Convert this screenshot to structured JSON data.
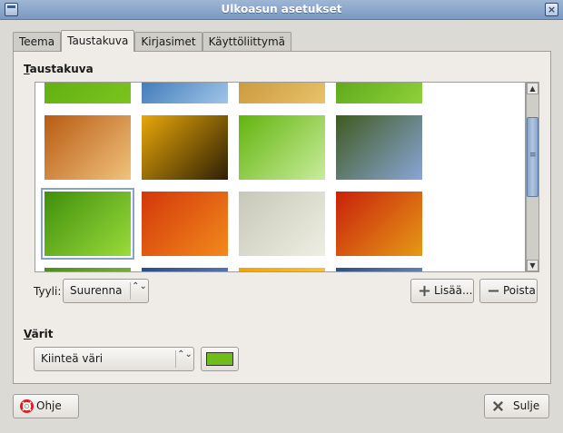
{
  "window": {
    "title": "Ulkoasun asetukset",
    "close_glyph": "×"
  },
  "tabs": [
    {
      "label": "Teema",
      "active": false
    },
    {
      "label": "Taustakuva",
      "active": true
    },
    {
      "label": "Kirjasimet",
      "active": false
    },
    {
      "label": "Käyttöliittymä",
      "active": false
    }
  ],
  "background_section": {
    "heading_first": "T",
    "heading_rest": "austakuva"
  },
  "wallpapers": [
    {
      "name": "green-abstract",
      "colors": [
        "#57a80c",
        "#7cc41f"
      ]
    },
    {
      "name": "blue-waves",
      "colors": [
        "#1f5fa8",
        "#9fc5e8"
      ]
    },
    {
      "name": "golden-grass",
      "colors": [
        "#c18b2c",
        "#e8c26b"
      ]
    },
    {
      "name": "green-leaf-stripes",
      "colors": [
        "#4e9a0e",
        "#8fd13b"
      ]
    },
    {
      "name": "dandelion-seed",
      "colors": [
        "#b85b12",
        "#f1c27d"
      ]
    },
    {
      "name": "yellow-flower",
      "colors": [
        "#e8a70a",
        "#2d2005"
      ]
    },
    {
      "name": "green-ribbon",
      "colors": [
        "#63b40e",
        "#c9ec9c"
      ]
    },
    {
      "name": "blue-flowers",
      "colors": [
        "#3f5a20",
        "#8aa5d6"
      ]
    },
    {
      "name": "green-leaf",
      "colors": [
        "#3f8f0c",
        "#9bdb3b"
      ]
    },
    {
      "name": "orange-flower",
      "colors": [
        "#d3370a",
        "#f28a1c"
      ]
    },
    {
      "name": "pale-wood",
      "colors": [
        "#c7c8b9",
        "#eeeee2"
      ]
    },
    {
      "name": "red-marigold",
      "colors": [
        "#c9200b",
        "#e59a16"
      ]
    },
    {
      "name": "green-partial",
      "colors": [
        "#4d8c1a",
        "#90c45a"
      ]
    },
    {
      "name": "blue-partial",
      "colors": [
        "#2b4c8a",
        "#6f8fc6"
      ]
    },
    {
      "name": "orange-partial",
      "colors": [
        "#f0a400",
        "#ffd262"
      ]
    },
    {
      "name": "steel-partial",
      "colors": [
        "#2e4f82",
        "#8aa3c9"
      ]
    }
  ],
  "style": {
    "label": "Tyyli:",
    "value": "Suurenna",
    "arrows": "⌃⌄"
  },
  "add_button": {
    "label": "Lisää..."
  },
  "remove_button": {
    "label": "Poista"
  },
  "colors_section": {
    "heading_first": "V",
    "heading_rest": "ärit"
  },
  "color_mode": {
    "value": "Kiinteä väri",
    "arrows": "⌃⌄"
  },
  "color_swatch": {
    "value": "#6ebd1b"
  },
  "help_button": {
    "label": "Ohje"
  },
  "close_button": {
    "label": "Sulje"
  }
}
